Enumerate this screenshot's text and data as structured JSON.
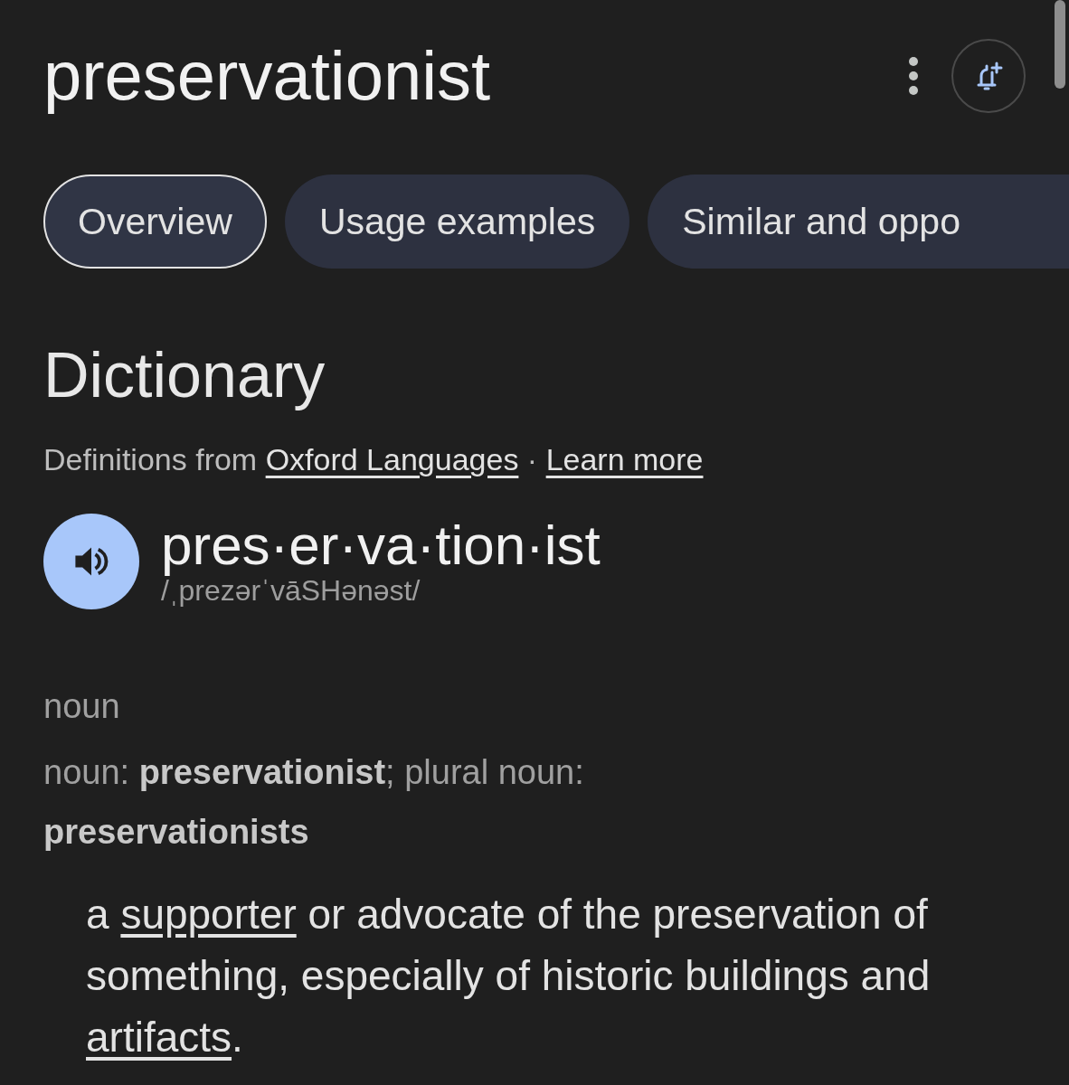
{
  "header": {
    "title": "preservationist"
  },
  "tabs": [
    {
      "label": "Overview",
      "selected": true
    },
    {
      "label": "Usage examples",
      "selected": false
    },
    {
      "label": "Similar and oppo",
      "selected": false
    }
  ],
  "section": {
    "heading": "Dictionary",
    "source": [
      {
        "text": "Definitions from ",
        "link": false
      },
      {
        "text": "Oxford Languages",
        "link": true
      },
      {
        "text": " · ",
        "link": false
      },
      {
        "text": "Learn more",
        "link": true
      }
    ]
  },
  "entry": {
    "syllables": "pres·er·va·tion·ist",
    "phonetic": "/ˌprezərˈvāSHənəst/",
    "part_of_speech": "noun",
    "grammar": "noun: **preservationist**; plural noun: **preservationists**",
    "definition": [
      {
        "text": "a ",
        "link": false
      },
      {
        "text": "supporter",
        "link": true
      },
      {
        "text": " or advocate of the preservation of something, especially of historic buildings and ",
        "link": false
      },
      {
        "text": "artifacts",
        "link": true
      },
      {
        "text": ".",
        "link": false
      }
    ]
  }
}
